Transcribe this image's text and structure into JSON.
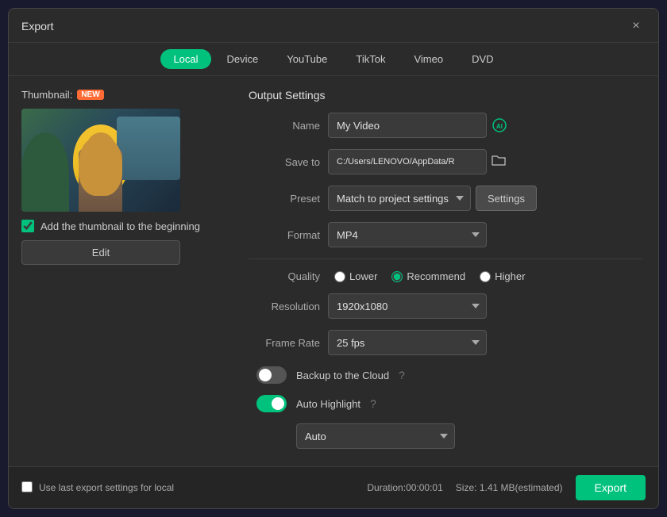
{
  "dialog": {
    "title": "Export",
    "close_label": "×"
  },
  "tabs": [
    {
      "id": "local",
      "label": "Local",
      "active": true
    },
    {
      "id": "device",
      "label": "Device",
      "active": false
    },
    {
      "id": "youtube",
      "label": "YouTube",
      "active": false
    },
    {
      "id": "tiktok",
      "label": "TikTok",
      "active": false
    },
    {
      "id": "vimeo",
      "label": "Vimeo",
      "active": false
    },
    {
      "id": "dvd",
      "label": "DVD",
      "active": false
    }
  ],
  "thumbnail": {
    "label": "Thumbnail:",
    "badge": "NEW",
    "checkbox_label": "Add the thumbnail to the beginning",
    "edit_label": "Edit"
  },
  "output_settings": {
    "section_title": "Output Settings",
    "name_label": "Name",
    "name_value": "My Video",
    "save_to_label": "Save to",
    "save_path": "C:/Users/LENOVO/AppData/R",
    "preset_label": "Preset",
    "preset_value": "Match to project settings",
    "settings_label": "Settings",
    "format_label": "Format",
    "format_value": "MP4",
    "quality_label": "Quality",
    "quality_lower": "Lower",
    "quality_recommend": "Recommend",
    "quality_higher": "Higher",
    "resolution_label": "Resolution",
    "resolution_value": "1920x1080",
    "framerate_label": "Frame Rate",
    "framerate_value": "25 fps"
  },
  "toggles": {
    "backup_label": "Backup to the Cloud",
    "backup_checked": false,
    "auto_highlight_label": "Auto Highlight",
    "auto_highlight_checked": true,
    "auto_value": "Auto"
  },
  "footer": {
    "use_last_label": "Use last export settings for local",
    "duration_label": "Duration:",
    "duration_value": "00:00:01",
    "size_label": "Size:",
    "size_value": "1.41 MB(estimated)",
    "export_label": "Export"
  }
}
